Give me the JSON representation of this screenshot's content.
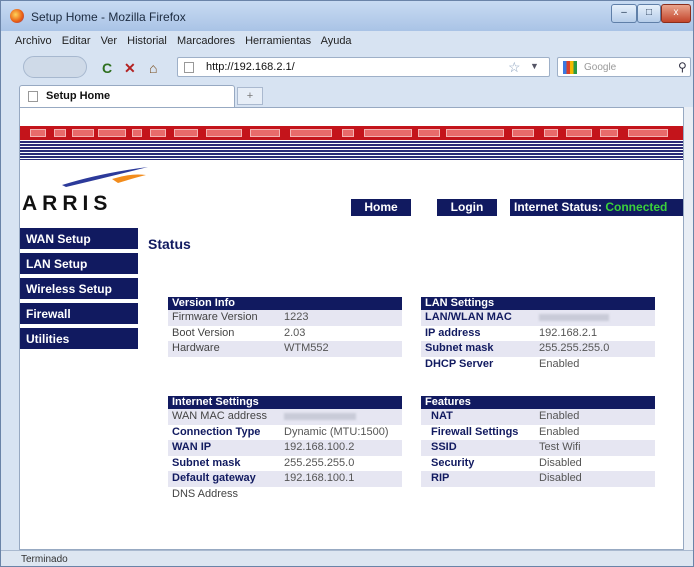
{
  "window": {
    "title": "Setup Home - Mozilla Firefox",
    "min": "–",
    "max": "□",
    "close": "x"
  },
  "menu": [
    "Archivo",
    "Editar",
    "Ver",
    "Historial",
    "Marcadores",
    "Herramientas",
    "Ayuda"
  ],
  "nav": {
    "url": "http://192.168.2.1/",
    "search_placeholder": "Google"
  },
  "tab": {
    "title": "Setup Home",
    "newtab": "+"
  },
  "page": {
    "logo": "ARRIS",
    "top_buttons": {
      "home": "Home",
      "login": "Login",
      "status_label": "Internet Status:",
      "status_value": "Connected"
    },
    "sidebar": [
      "WAN Setup",
      "LAN Setup",
      "Wireless Setup",
      "Firewall",
      "Utilities"
    ],
    "title": "Status",
    "version_info": {
      "header": "Version Info",
      "rows": [
        [
          "Firmware Version",
          "1223"
        ],
        [
          "Boot Version",
          "2.03"
        ],
        [
          "Hardware",
          "WTM552"
        ]
      ]
    },
    "lan_settings": {
      "header": "LAN Settings",
      "rows": [
        [
          "LAN/WLAN MAC",
          ""
        ],
        [
          "IP address",
          "192.168.2.1"
        ],
        [
          "Subnet mask",
          "255.255.255.0"
        ],
        [
          "DHCP Server",
          "Enabled"
        ]
      ]
    },
    "internet_settings": {
      "header": "Internet Settings",
      "rows": [
        [
          "WAN MAC address",
          ""
        ],
        [
          "Connection Type",
          "Dynamic (MTU:1500)"
        ],
        [
          "WAN IP",
          "192.168.100.2"
        ],
        [
          "Subnet mask",
          "255.255.255.0"
        ],
        [
          "Default gateway",
          "192.168.100.1"
        ],
        [
          "DNS Address",
          ""
        ]
      ]
    },
    "features": {
      "header": "Features",
      "rows": [
        [
          "NAT",
          "Enabled"
        ],
        [
          "Firewall Settings",
          "Enabled"
        ],
        [
          "SSID",
          "Test Wifi"
        ],
        [
          "Security",
          "Disabled"
        ],
        [
          "RIP",
          "Disabled"
        ]
      ]
    }
  },
  "statusbar": "Terminado",
  "colors": {
    "navy": "#111a60",
    "banner_red": "#c4141b",
    "connected_green": "#3bd13b"
  }
}
